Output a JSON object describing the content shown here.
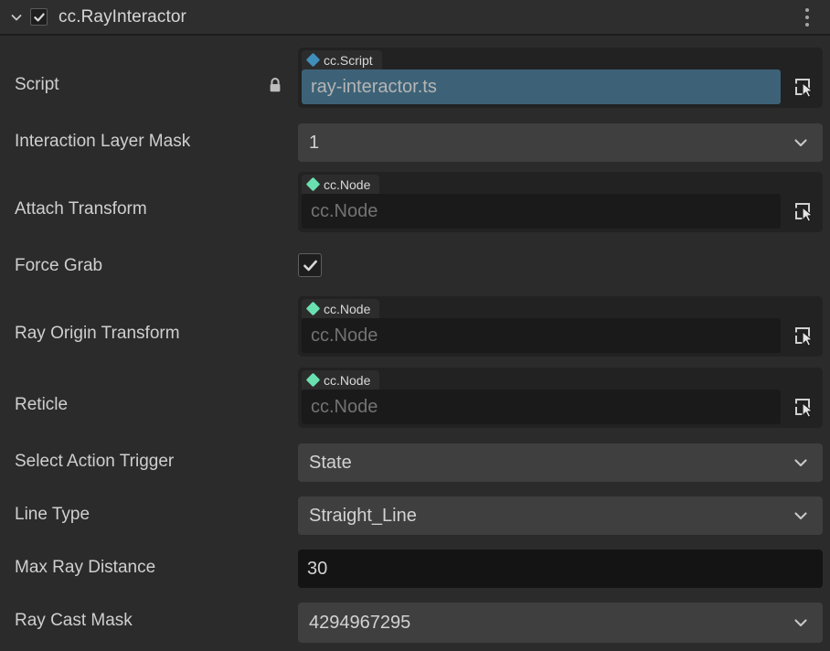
{
  "header": {
    "title": "cc.RayInteractor",
    "enabled_checkbox": true,
    "foldout_state": "expanded",
    "foldout_icon": "chevron-down-icon",
    "menu_icon": "kebab-menu-icon"
  },
  "theme": {
    "background": "#2b2b2b",
    "header_background": "#2e2e2e",
    "label_color": "#cfcfcf",
    "dropdown_background": "#3f3f3f",
    "input_background": "#141414",
    "object_field_background": "#222222",
    "empty_slot_background": "#1a1a1a",
    "selection_blue": "#3d6277",
    "script_diamond": "#3f8ebb",
    "node_diamond": "#6ae0b0"
  },
  "properties": [
    {
      "label": "Script",
      "kind": "object",
      "locked": true,
      "lock_icon": "lock-closed-icon",
      "tag": "cc.Script",
      "tag_icon": "script-diamond-icon",
      "tag_color": "#3f8ebb",
      "value": "ray-interactor.ts",
      "selected": true,
      "picker_icon": "node-picker-icon"
    },
    {
      "label": "Interaction Layer Mask",
      "kind": "dropdown",
      "value": "1",
      "chevron_icon": "chevron-down-icon"
    },
    {
      "label": "Attach Transform",
      "kind": "object",
      "locked": false,
      "tag": "cc.Node",
      "tag_icon": "node-diamond-icon",
      "tag_color": "#6ae0b0",
      "value": "cc.Node",
      "selected": false,
      "picker_icon": "node-picker-icon"
    },
    {
      "label": "Force Grab",
      "kind": "boolean",
      "value": true,
      "check_icon": "checkmark-icon"
    },
    {
      "label": "Ray Origin Transform",
      "kind": "object",
      "locked": false,
      "tag": "cc.Node",
      "tag_icon": "node-diamond-icon",
      "tag_color": "#6ae0b0",
      "value": "cc.Node",
      "selected": false,
      "picker_icon": "node-picker-icon"
    },
    {
      "label": "Reticle",
      "kind": "object",
      "locked": false,
      "tag": "cc.Node",
      "tag_icon": "node-diamond-icon",
      "tag_color": "#6ae0b0",
      "value": "cc.Node",
      "selected": false,
      "picker_icon": "node-picker-icon"
    },
    {
      "label": "Select Action Trigger",
      "kind": "dropdown",
      "value": "State",
      "chevron_icon": "chevron-down-icon"
    },
    {
      "label": "Line Type",
      "kind": "dropdown",
      "value": "Straight_Line",
      "chevron_icon": "chevron-down-icon"
    },
    {
      "label": "Max Ray Distance",
      "kind": "number",
      "value": "30"
    },
    {
      "label": "Ray Cast Mask",
      "kind": "dropdown",
      "value": "4294967295",
      "chevron_icon": "chevron-down-icon"
    }
  ]
}
